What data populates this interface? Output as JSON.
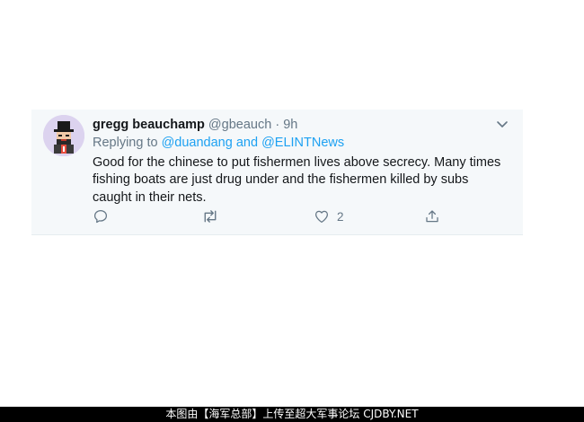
{
  "tweet": {
    "display_name": "gregg beauchamp",
    "handle": "@gbeauch",
    "separator": "·",
    "time": "9h",
    "reply_prefix": "Replying to ",
    "mention_1": "@duandang",
    "reply_and": " and ",
    "mention_2": "@ELINTNews",
    "text": "Good for the chinese to put fishermen lives above secrecy. Many times fishing boats are just drug under and the fishermen killed by subs caught in their nets.",
    "like_count": "2"
  },
  "icons": {
    "reply": "reply-icon",
    "retweet": "retweet-icon",
    "like": "heart-icon",
    "share": "share-icon",
    "menu": "chevron-down-icon"
  },
  "colors": {
    "card_bg": "#f5f8fa",
    "link": "#1da1f2",
    "muted": "#657786",
    "text": "#14171a"
  },
  "footer": {
    "watermark": "本图由【海军总部】上传至超大军事论坛 CJDBY.NET"
  }
}
